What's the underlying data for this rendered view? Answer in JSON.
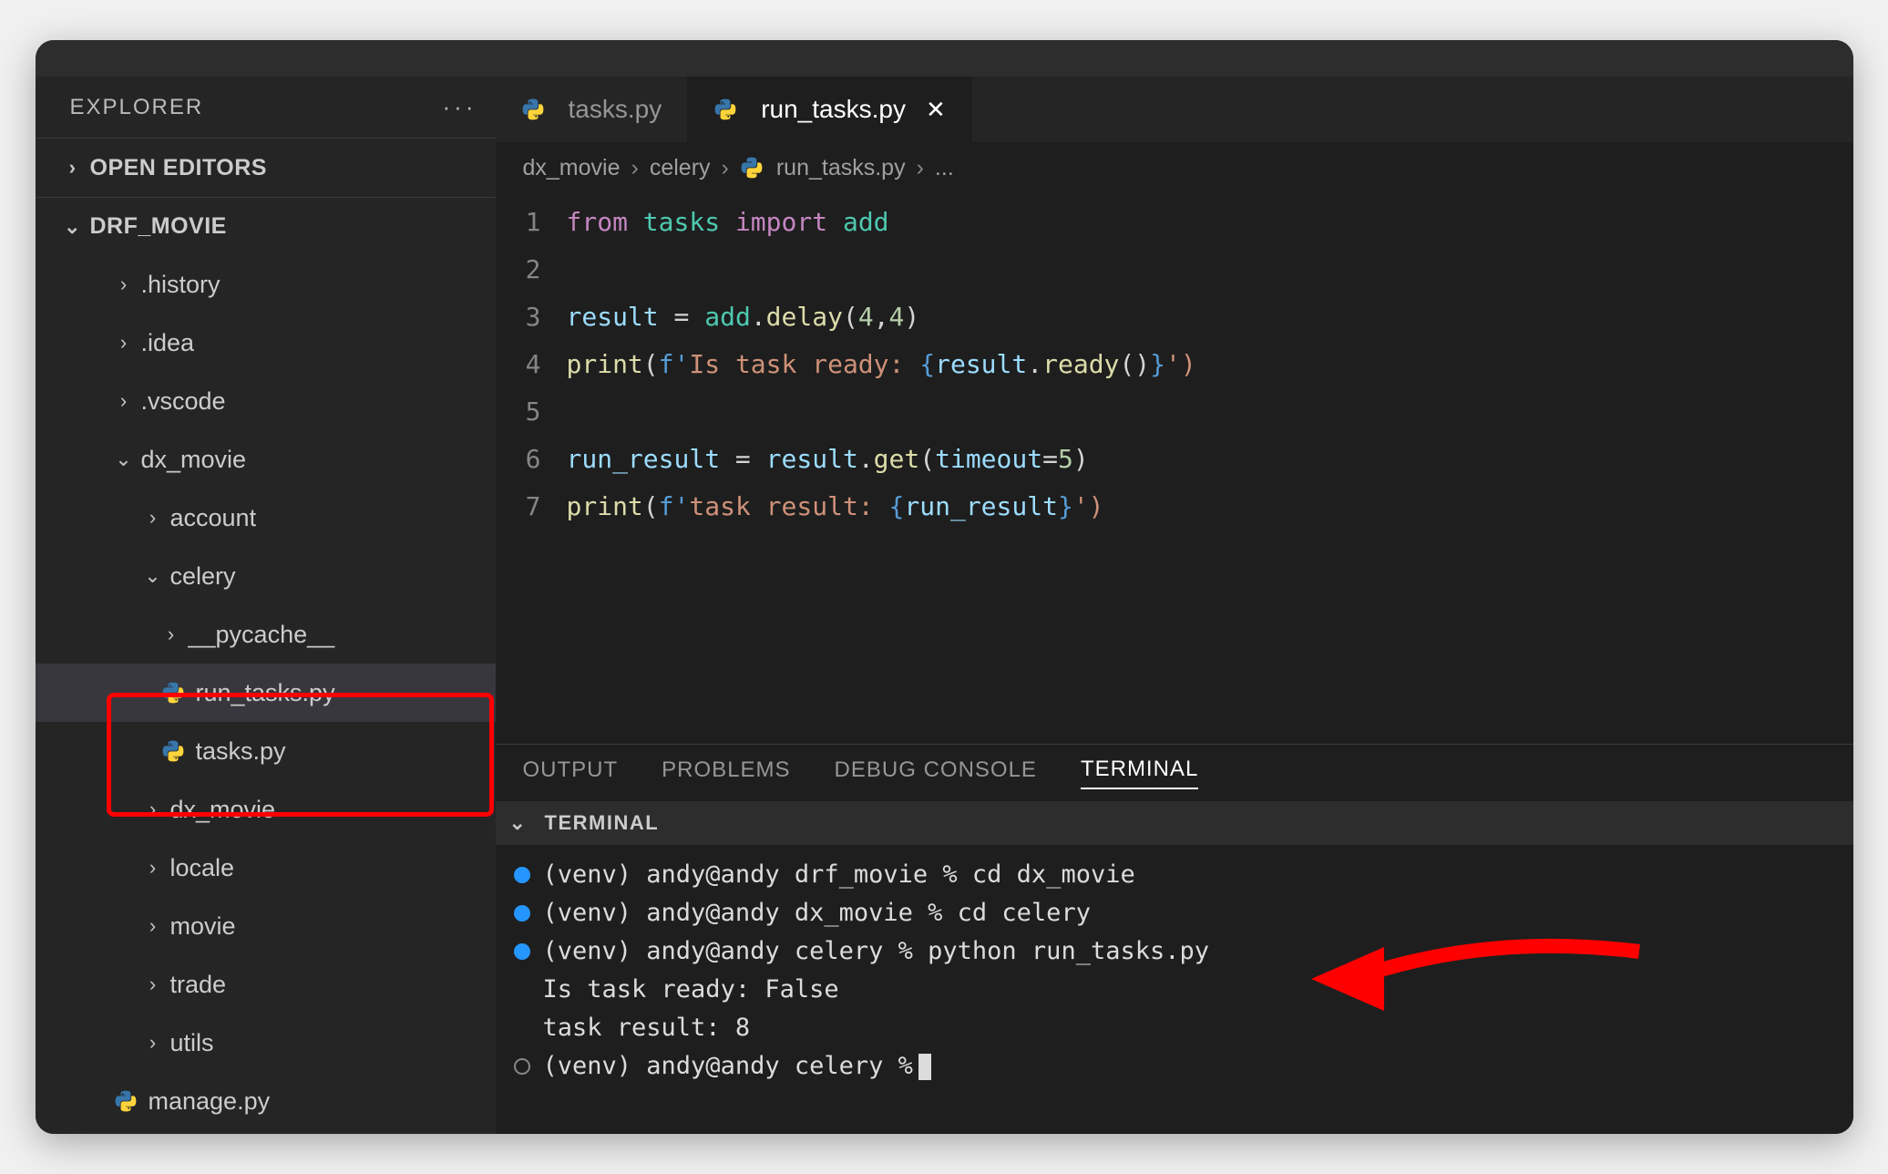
{
  "sidebar": {
    "title": "EXPLORER",
    "sections": {
      "open_editors": "OPEN EDITORS",
      "workspace": "DRF_MOVIE"
    },
    "tree": {
      "history": ".history",
      "idea": ".idea",
      "vscode": ".vscode",
      "dx_movie": "dx_movie",
      "account": "account",
      "celery": "celery",
      "pycache": "__pycache__",
      "run_tasks": "run_tasks.py",
      "tasks": "tasks.py",
      "dx_movie2": "dx_movie",
      "locale": "locale",
      "movie": "movie",
      "trade": "trade",
      "utils": "utils",
      "manage": "manage.py"
    }
  },
  "tabs": {
    "inactive": "tasks.py",
    "active": "run_tasks.py"
  },
  "breadcrumb": {
    "p1": "dx_movie",
    "p2": "celery",
    "p3": "run_tasks.py",
    "p4": "..."
  },
  "code": {
    "l1": {
      "from": "from",
      "module": "tasks",
      "import": "import",
      "name": "add"
    },
    "l3": {
      "var": "result",
      "eq": " = ",
      "fn": "add",
      "dot": ".",
      "method": "delay",
      "args_open": "(",
      "n1": "4",
      "comma": ",",
      "n2": "4",
      "args_close": ")"
    },
    "l4": {
      "print": "print",
      "open": "(",
      "f": "f'",
      "text1": "Is task ready: ",
      "lb": "{",
      "var": "result",
      "dot": ".",
      "method": "ready",
      "call": "()",
      "rb": "}",
      "close": "')"
    },
    "l6": {
      "var": "run_result",
      "eq": " = ",
      "obj": "result",
      "dot": ".",
      "method": "get",
      "open": "(",
      "kw": "timeout",
      "assign": "=",
      "val": "5",
      "close": ")"
    },
    "l7": {
      "print": "print",
      "open": "(",
      "f": "f'",
      "text1": "task result: ",
      "lb": "{",
      "var": "run_result",
      "rb": "}",
      "close": "')"
    }
  },
  "panel": {
    "tabs": {
      "output": "OUTPUT",
      "problems": "PROBLEMS",
      "debug": "DEBUG CONSOLE",
      "terminal": "TERMINAL"
    },
    "section": "TERMINAL",
    "lines": {
      "l1": "(venv) andy@andy drf_movie % cd dx_movie",
      "l2": "(venv) andy@andy dx_movie % cd celery",
      "l3": "(venv) andy@andy celery % python run_tasks.py",
      "l4": "Is task ready: False",
      "l5": "task result: 8",
      "l6": "(venv) andy@andy celery % "
    }
  }
}
